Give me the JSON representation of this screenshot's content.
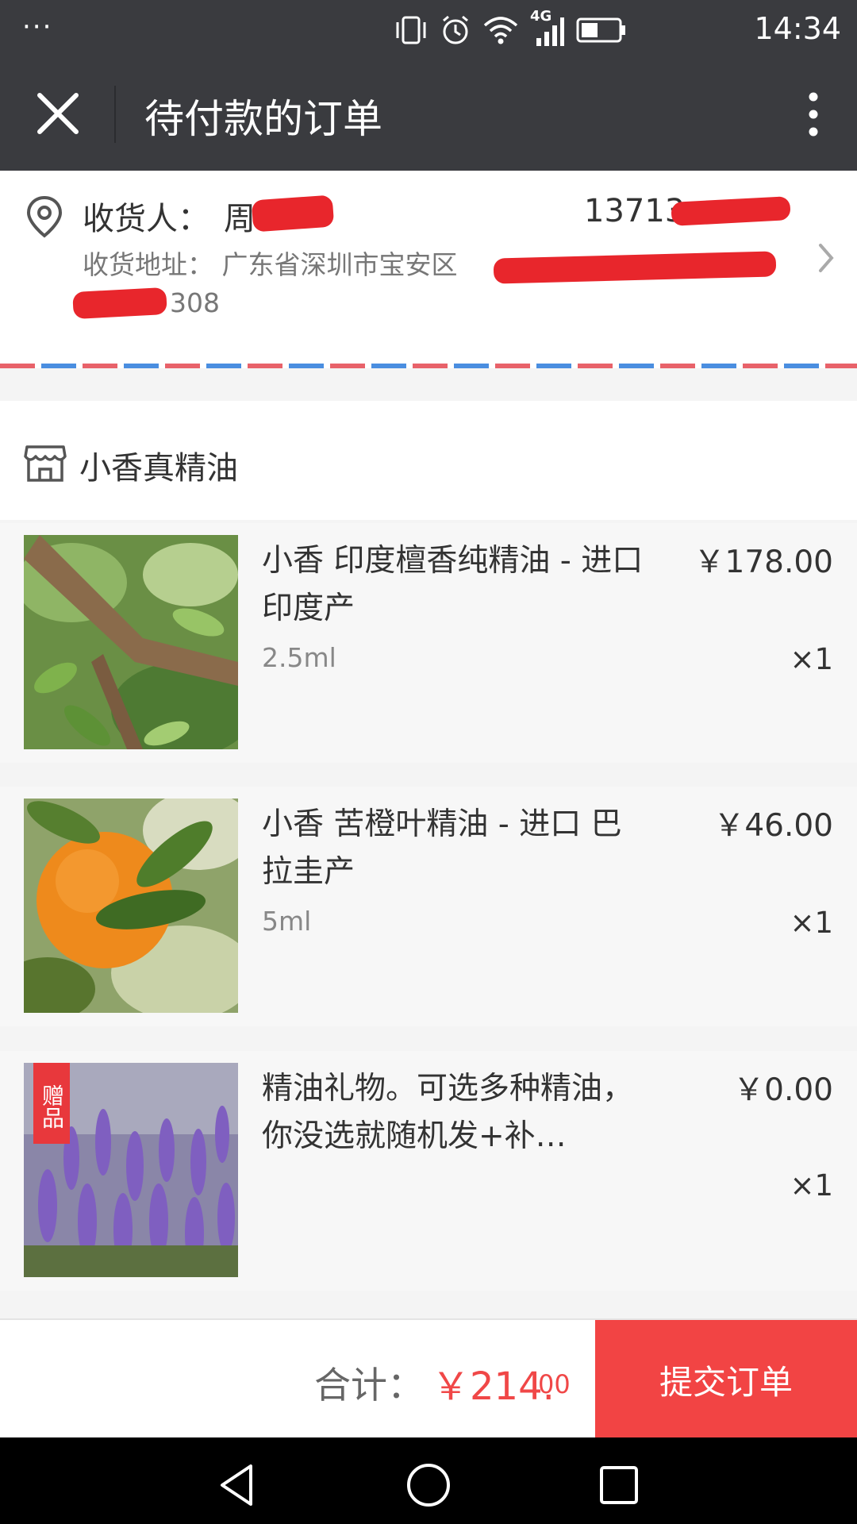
{
  "status_bar": {
    "menu_dots": "···",
    "time": "14:34",
    "network": "4G",
    "icons": [
      "vibrate-icon",
      "alarm-icon",
      "wifi-icon",
      "signal-icon",
      "battery-icon"
    ]
  },
  "header": {
    "title": "待付款的订单",
    "icons": [
      "close-icon",
      "more-icon"
    ]
  },
  "address": {
    "receiver_label": "收货人：",
    "receiver_name": "周",
    "phone": "13713",
    "address_text": "收货地址：  广东省深圳市宝安区",
    "address_line2": "308"
  },
  "store": {
    "name": "小香真精油"
  },
  "items": [
    {
      "name": "小香 印度檀香纯精油 - 进口 印度产",
      "spec": "2.5ml",
      "price": "￥178.00",
      "qty": "×1"
    },
    {
      "name": "小香 苦橙叶精油 - 进口 巴拉圭产",
      "spec": "5ml",
      "price": "￥46.00",
      "qty": "×1"
    },
    {
      "name": "精油礼物。可选多种精油，你没选就随机发+补…",
      "spec": "",
      "price": "￥0.00",
      "qty": "×1",
      "badge": "赠品"
    }
  ],
  "footer": {
    "total_label": "合计：",
    "total_int": "￥214.",
    "total_dec": "00",
    "submit_label": "提交订单"
  },
  "colors": {
    "accent": "#f24444",
    "header_bg": "#3a3b3f"
  }
}
